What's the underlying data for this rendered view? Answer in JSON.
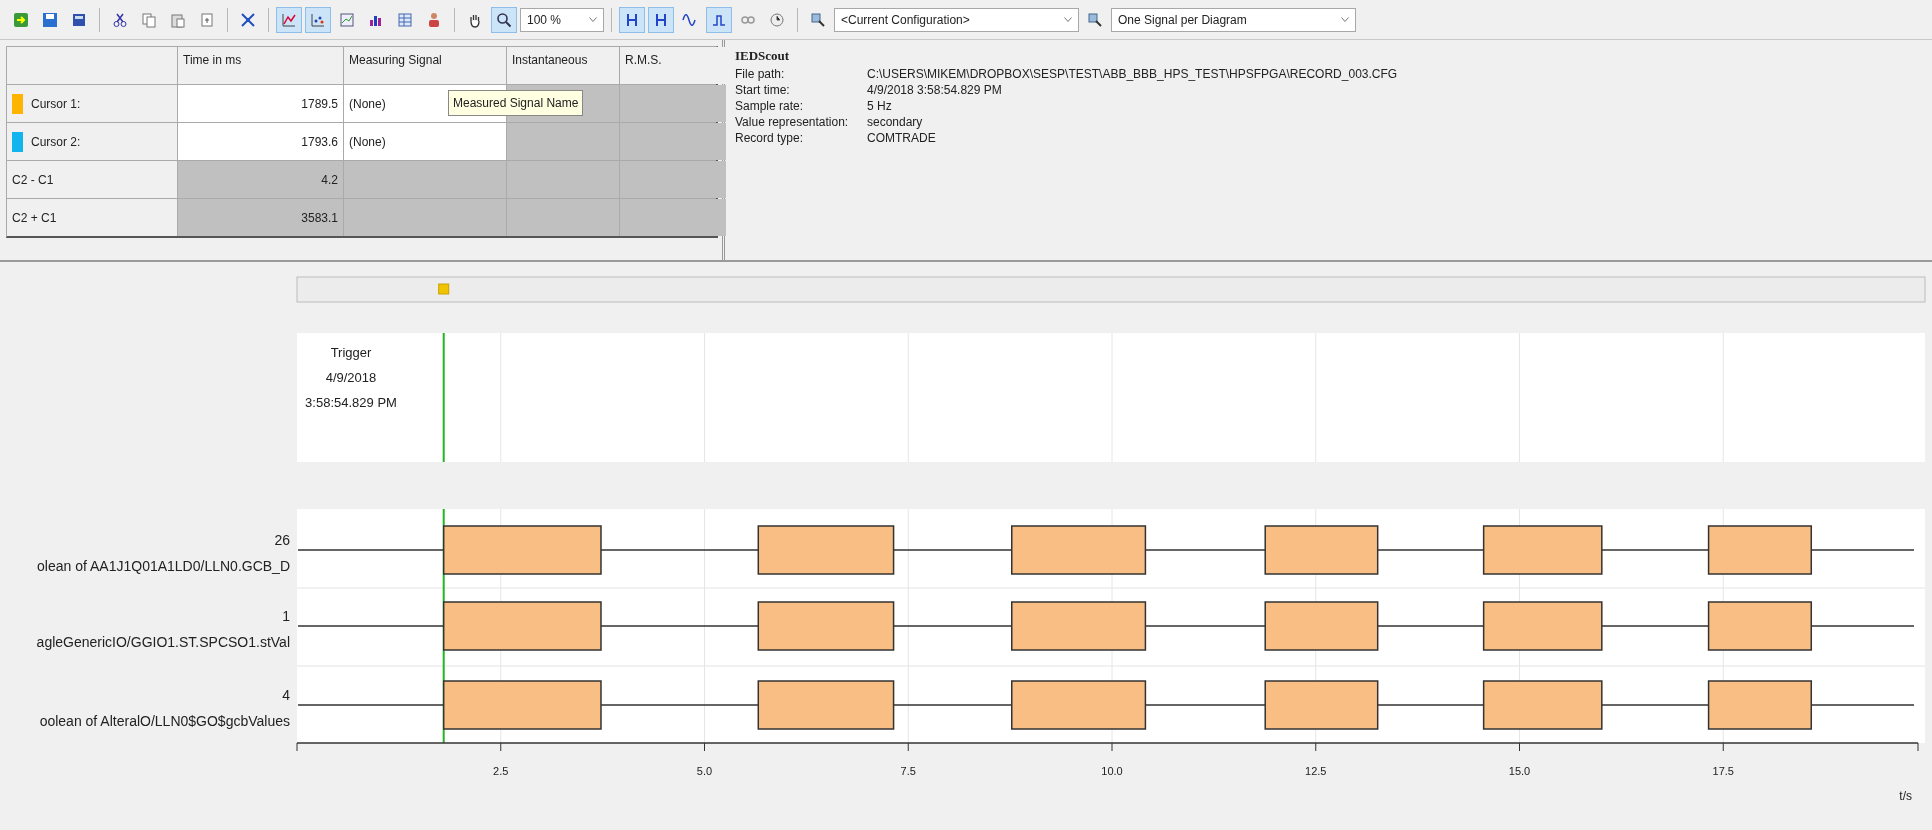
{
  "toolbar": [
    {
      "kind": "import",
      "pressed": false
    },
    {
      "kind": "save",
      "pressed": false
    },
    {
      "kind": "save-all",
      "pressed": false
    },
    {
      "kind": "separator"
    },
    {
      "kind": "cut",
      "pressed": false
    },
    {
      "kind": "copy",
      "pressed": false
    },
    {
      "kind": "paste",
      "pressed": false
    },
    {
      "kind": "export",
      "pressed": false
    },
    {
      "kind": "separator"
    },
    {
      "kind": "network",
      "pressed": false
    },
    {
      "kind": "separator"
    },
    {
      "kind": "curve-chart",
      "pressed": true
    },
    {
      "kind": "scatter-chart",
      "pressed": true
    },
    {
      "kind": "xy-chart",
      "pressed": false
    },
    {
      "kind": "bar-chart",
      "pressed": false
    },
    {
      "kind": "table",
      "pressed": false
    },
    {
      "kind": "person",
      "pressed": false
    },
    {
      "kind": "separator"
    },
    {
      "kind": "hand",
      "pressed": false
    },
    {
      "kind": "search",
      "pressed": true
    },
    {
      "kind": "combo",
      "value": "100 %",
      "wide": false
    },
    {
      "kind": "separator"
    },
    {
      "kind": "cursor",
      "pressed": true
    },
    {
      "kind": "cursor",
      "pressed": true
    },
    {
      "kind": "wave",
      "pressed": false
    },
    {
      "kind": "step",
      "pressed": true
    },
    {
      "kind": "loop",
      "pressed": false
    },
    {
      "kind": "clock",
      "pressed": false
    },
    {
      "kind": "separator"
    },
    {
      "kind": "config",
      "pressed": false
    },
    {
      "kind": "combo",
      "value": "<Current Configuration>",
      "wide": true
    },
    {
      "kind": "config",
      "pressed": false
    },
    {
      "kind": "combo",
      "value": "One Signal per Diagram",
      "wide": true
    }
  ],
  "cursor_table": {
    "columns": [
      "Time in ms",
      "Measuring Signal",
      "Instantaneous",
      "R.M.S."
    ],
    "rows": [
      {
        "label": "Cursor 1:",
        "color": "#ffb400",
        "cells": [
          {
            "text": "1789.5",
            "disabled": false
          },
          {
            "text": "(None)",
            "disabled": false
          },
          {
            "text": "",
            "disabled": true
          },
          {
            "text": "",
            "disabled": true
          }
        ]
      },
      {
        "label": "Cursor 2:",
        "color": "#12b4f0",
        "cells": [
          {
            "text": "1793.6",
            "disabled": false
          },
          {
            "text": "(None)",
            "disabled": false
          },
          {
            "text": "",
            "disabled": true
          },
          {
            "text": "",
            "disabled": true
          }
        ]
      },
      {
        "label": "C2 - C1",
        "cells": [
          {
            "text": "4.2",
            "disabled": true
          },
          {
            "text": "",
            "disabled": true
          },
          {
            "text": "",
            "disabled": true
          },
          {
            "text": "",
            "disabled": true
          }
        ]
      },
      {
        "label": "C2 + C1",
        "cells": [
          {
            "text": "3583.1",
            "disabled": true
          },
          {
            "text": "",
            "disabled": true
          },
          {
            "text": "",
            "disabled": true
          },
          {
            "text": "",
            "disabled": true
          }
        ]
      }
    ],
    "tooltip": "Measured Signal Name"
  },
  "info": {
    "title": "IEDScout",
    "fields": [
      {
        "label": "File path:",
        "value": "C:\\USERS\\MIKEM\\DROPBOX\\SESP\\TEST\\ABB_BBB_HPS_TEST\\HPSFPGA\\RECORD_003.CFG"
      },
      {
        "label": "Start time:",
        "value": "4/9/2018 3:58:54.829 PM"
      },
      {
        "label": "Sample rate:",
        "value": "5 Hz"
      },
      {
        "label": "Value representation:",
        "value": "secondary"
      },
      {
        "label": "Record type:",
        "value": "COMTRADE"
      }
    ]
  },
  "trigger": {
    "lines": [
      "Trigger",
      "4/9/2018",
      "3:58:54.829 PM"
    ]
  },
  "signals": [
    {
      "number": "26",
      "name": "olean of AA1J1Q01A1LD0/LLN0.GCB_D"
    },
    {
      "number": "1",
      "name": "agleGenericIO/GGIO1.ST.SPCSO1.stVal"
    },
    {
      "number": "4",
      "name": "oolean of AlteralO/LLN0$GO$gcbValues"
    }
  ],
  "time_axis": {
    "ticks": [
      "2.5",
      "5.0",
      "7.5",
      "10.0",
      "12.5",
      "15.0",
      "17.5"
    ],
    "label": "t/s"
  }
}
